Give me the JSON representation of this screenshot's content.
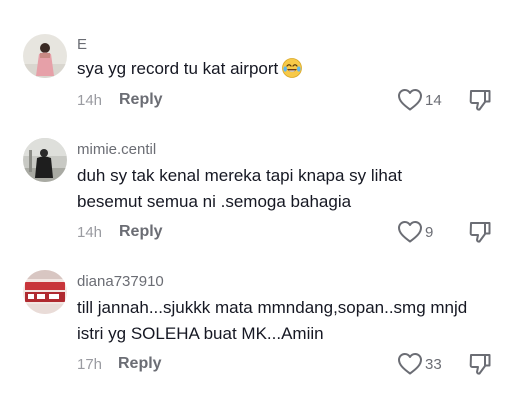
{
  "comments": [
    {
      "username": "E",
      "text": "sya yg record tu kat airport",
      "emoji": "laughing-tears-emoji",
      "time": "14h",
      "reply_label": "Reply",
      "likes": "14"
    },
    {
      "username": "mimie.centil",
      "text": "duh sy tak kenal mereka tapi knapa sy lihat besemut semua ni .semoga bahagia",
      "time": "14h",
      "reply_label": "Reply",
      "likes": "9"
    },
    {
      "username": "diana737910",
      "text": "till jannah...sjukkk mata mmndang,sopan..smg mnjd istri yg SOLEHA buat MK...Amiin",
      "time": "17h",
      "reply_label": "Reply",
      "likes": "33"
    }
  ],
  "colors": {
    "text_primary": "#161823",
    "text_secondary": "#6b6d74",
    "text_muted": "#9a9ba1"
  }
}
